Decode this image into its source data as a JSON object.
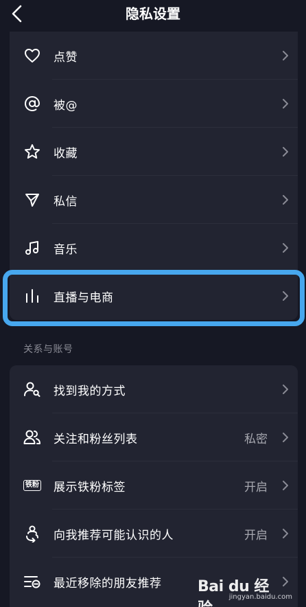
{
  "header": {
    "title": "隐私设置"
  },
  "group1": {
    "items": [
      {
        "label": "点赞",
        "icon": "heart-icon"
      },
      {
        "label": "被@",
        "icon": "at-icon"
      },
      {
        "label": "收藏",
        "icon": "star-icon"
      },
      {
        "label": "私信",
        "icon": "send-icon"
      },
      {
        "label": "音乐",
        "icon": "music-icon"
      },
      {
        "label": "直播与电商",
        "icon": "live-bars-icon"
      }
    ]
  },
  "group2": {
    "section_label": "关系与账号",
    "items": [
      {
        "label": "找到我的方式",
        "value": "",
        "icon": "find-user-icon"
      },
      {
        "label": "关注和粉丝列表",
        "value": "私密",
        "icon": "users-icon"
      },
      {
        "label": "展示铁粉标签",
        "value": "开启",
        "icon": "tie-fan-badge-icon",
        "badge_text": "铁粉"
      },
      {
        "label": "向我推荐可能认识的人",
        "value": "开启",
        "icon": "recommend-icon"
      },
      {
        "label": "最近移除的朋友推荐",
        "value": "",
        "icon": "removed-list-icon"
      }
    ]
  },
  "watermark": {
    "logo": "Bai du 经验",
    "url": "jingyan.baidu.com"
  },
  "colors": {
    "background": "#161824",
    "card": "#222431",
    "highlight": "#47a7ee",
    "secondary_text": "#a7a8b0"
  }
}
